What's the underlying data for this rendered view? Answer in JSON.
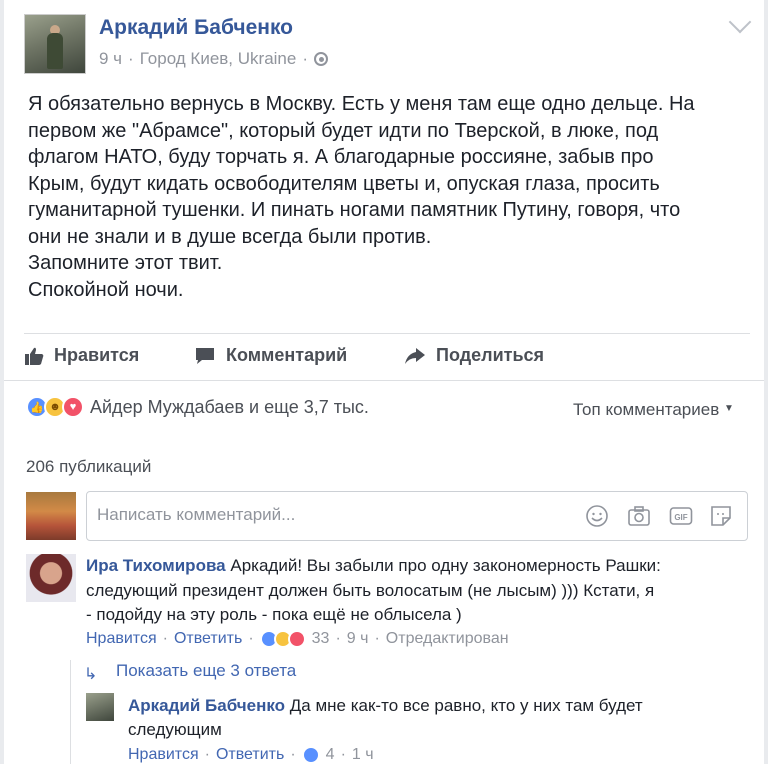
{
  "post": {
    "author": "Аркадий Бабченко",
    "time": "9 ч",
    "sep1": "·",
    "location": "Город Киев, Ukraine",
    "sep2": "·",
    "lines": [
      "Я обязательно вернусь в Москву. Есть у меня там еще одно дельце. На",
      "первом же \"Абрамсе\", который будет идти по Тверской, в люке, под",
      "флагом НАТО, буду торчать я. А благодарные россияне, забыв про",
      "Крым, будут кидать освободителям цветы и, опуская глаза, просить",
      "гуманитарной тушенки. И пинать ногами памятник Путину, говоря, что",
      "они не знали и в душе всегда были против.",
      "Запомните этот твит.",
      "Спокойной ночи."
    ]
  },
  "actions": {
    "like": "Нравится",
    "comment": "Комментарий",
    "share": "Поделиться"
  },
  "reactions": {
    "text": "Айдер Муждабаев и еще 3,7 тыс.",
    "sort": "Топ комментариев"
  },
  "publications": "206 публикаций",
  "composer": {
    "placeholder": "Написать комментарий..."
  },
  "comment1": {
    "author": "Ира Тихомирова",
    "lines": [
      " Аркадий! Вы забыли про одну закономерность Рашки:",
      "следующий президент должен быть волосатым (не лысым) ))) Кстати, я",
      "- подойду на эту роль - пока ещё не облысела )"
    ],
    "like": "Нравится",
    "reply": "Ответить",
    "reaction_count": "33",
    "time": "9 ч",
    "edited": "Отредактирован",
    "sep": "·"
  },
  "more_replies": "Показать еще 3 ответа",
  "reply1": {
    "author": "Аркадий Бабченко",
    "lines": [
      " Да мне как-то все равно, кто у них там будет",
      "следующим"
    ],
    "like": "Нравится",
    "reply": "Ответить",
    "reaction_count": "4",
    "time": "1 ч",
    "sep": "·"
  },
  "colors": {
    "link": "#365899",
    "muted": "#90949c",
    "like_reaction": "#5890ff",
    "haha_reaction": "#f7c33f",
    "love_reaction": "#f25268"
  }
}
